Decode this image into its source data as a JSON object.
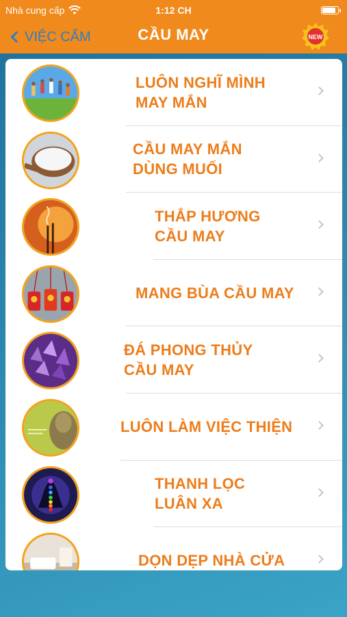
{
  "status_bar": {
    "carrier": "Nhà cung cấp",
    "time": "1:12 CH",
    "battery_level": 0.9
  },
  "nav": {
    "back_label": "VIỆC CẤM",
    "title": "CẦU MAY",
    "badge_text": "NEW"
  },
  "colors": {
    "orange": "#f08a1c",
    "label_orange": "#ec7d1b",
    "back_blue": "#2e7fc4",
    "ring": "#f4a21a"
  },
  "list": {
    "items": [
      {
        "line1": "LUÔN NGHĨ MÌNH",
        "line2": "MAY MẮN",
        "icon": "people-jumping-icon"
      },
      {
        "line1": "CẦU MAY MẮN",
        "line2": "DÙNG MUỐI",
        "icon": "salt-icon"
      },
      {
        "line1": "THẮP HƯƠNG",
        "line2": "CẦU MAY",
        "icon": "incense-icon"
      },
      {
        "line1": "MANG BÙA CẦU MAY",
        "line2": "",
        "icon": "amulet-icon"
      },
      {
        "line1": "ĐÁ PHONG THỦY",
        "line2": "CẦU MAY",
        "icon": "amethyst-icon"
      },
      {
        "line1": "LUÔN LÀM VIỆC THIỆN",
        "line2": "",
        "icon": "buddha-icon"
      },
      {
        "line1": "THANH LỌC",
        "line2": "LUÂN XA",
        "icon": "chakra-icon"
      },
      {
        "line1": "DỌN DẸP NHÀ CỬA",
        "line2": "",
        "icon": "living-room-icon"
      }
    ]
  }
}
